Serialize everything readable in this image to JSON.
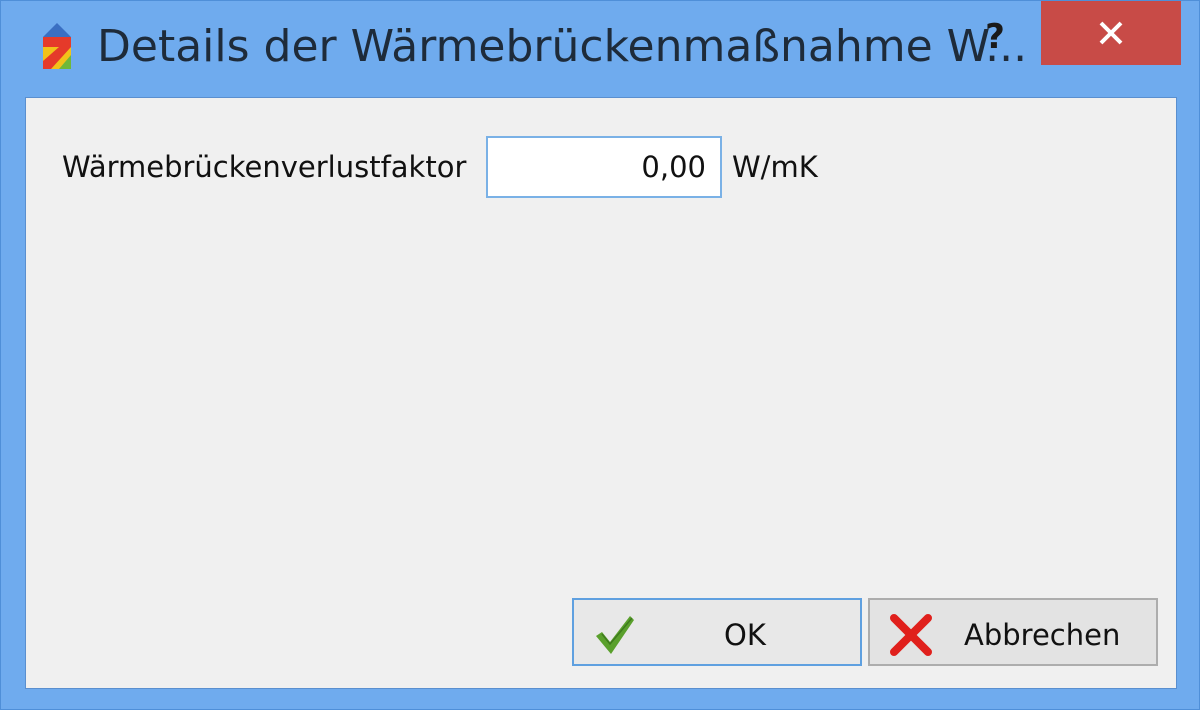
{
  "window": {
    "title": "Details der Wärmebrückenmaßnahme W...",
    "help_label": "?",
    "icon": "app-logo-icon",
    "close_icon": "close-icon"
  },
  "form": {
    "factor_label": "Wärmebrückenverlustfaktor",
    "factor_value": "0,00",
    "unit": "W/mK"
  },
  "buttons": {
    "ok_label": "OK",
    "ok_icon": "checkmark-icon",
    "cancel_label": "Abbrechen",
    "cancel_icon": "cross-icon"
  },
  "colors": {
    "titlebar": "#6fabee",
    "close_button": "#c84b47",
    "client_background": "#f0f0f0",
    "ok_check": "#5aa02c",
    "cancel_cross": "#e0201c"
  }
}
